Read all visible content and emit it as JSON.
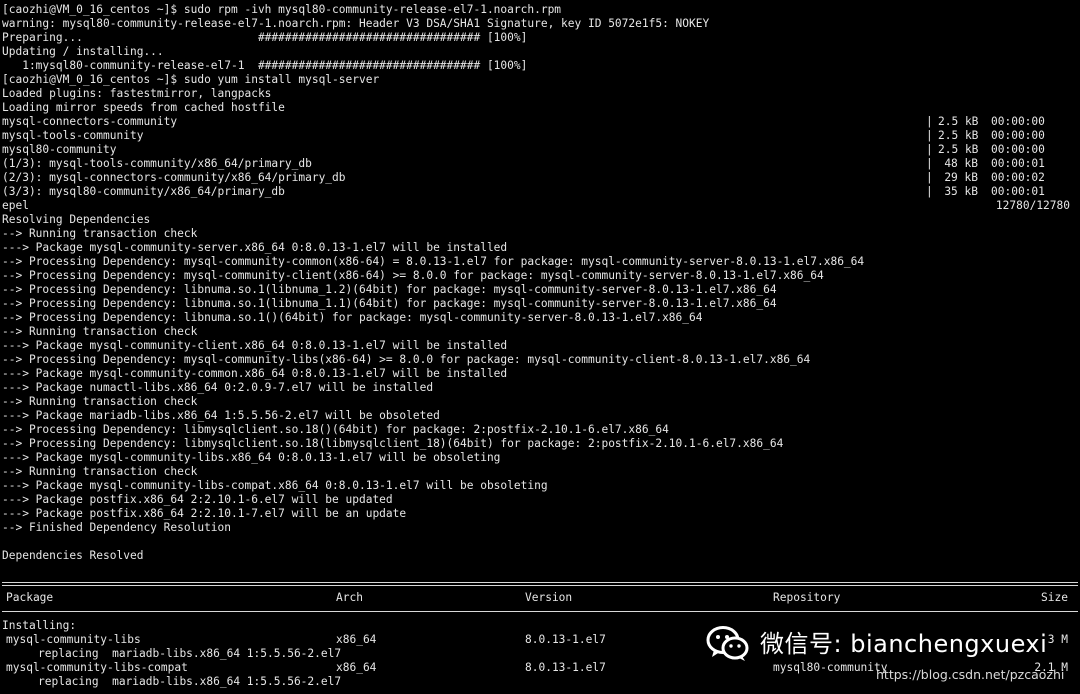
{
  "terminal": {
    "lines": [
      "[caozhi@VM_0_16_centos ~]$ sudo rpm -ivh mysql80-community-release-el7-1.noarch.rpm",
      "warning: mysql80-community-release-el7-1.noarch.rpm: Header V3 DSA/SHA1 Signature, key ID 5072e1f5: NOKEY",
      "Preparing...                          ################################# [100%]",
      "Updating / installing...",
      "   1:mysql80-community-release-el7-1  ################################# [100%]",
      "[caozhi@VM_0_16_centos ~]$ sudo yum install mysql-server",
      "Loaded plugins: fastestmirror, langpacks",
      "Loading mirror speeds from cached hostfile"
    ],
    "repo_lines": [
      {
        "name": "mysql-connectors-community",
        "bar": "|",
        "size": "2.5 kB",
        "time": "00:00:00"
      },
      {
        "name": "mysql-tools-community",
        "bar": "|",
        "size": "2.5 kB",
        "time": "00:00:00"
      },
      {
        "name": "mysql80-community",
        "bar": "|",
        "size": "2.5 kB",
        "time": "00:00:00"
      },
      {
        "name": "(1/3): mysql-tools-community/x86_64/primary_db",
        "bar": "|",
        "size": "48 kB",
        "time": "00:00:01"
      },
      {
        "name": "(2/3): mysql-connectors-community/x86_64/primary_db",
        "bar": "|",
        "size": "29 kB",
        "time": "00:00:02"
      },
      {
        "name": "(3/3): mysql80-community/x86_64/primary_db",
        "bar": "|",
        "size": "35 kB",
        "time": "00:00:01"
      }
    ],
    "epel": {
      "name": "epel",
      "count": "12780/12780"
    },
    "dep_lines": [
      "Resolving Dependencies",
      "--> Running transaction check",
      "---> Package mysql-community-server.x86_64 0:8.0.13-1.el7 will be installed",
      "--> Processing Dependency: mysql-community-common(x86-64) = 8.0.13-1.el7 for package: mysql-community-server-8.0.13-1.el7.x86_64",
      "--> Processing Dependency: mysql-community-client(x86-64) >= 8.0.0 for package: mysql-community-server-8.0.13-1.el7.x86_64",
      "--> Processing Dependency: libnuma.so.1(libnuma_1.2)(64bit) for package: mysql-community-server-8.0.13-1.el7.x86_64",
      "--> Processing Dependency: libnuma.so.1(libnuma_1.1)(64bit) for package: mysql-community-server-8.0.13-1.el7.x86_64",
      "--> Processing Dependency: libnuma.so.1()(64bit) for package: mysql-community-server-8.0.13-1.el7.x86_64",
      "--> Running transaction check",
      "---> Package mysql-community-client.x86_64 0:8.0.13-1.el7 will be installed",
      "--> Processing Dependency: mysql-community-libs(x86-64) >= 8.0.0 for package: mysql-community-client-8.0.13-1.el7.x86_64",
      "---> Package mysql-community-common.x86_64 0:8.0.13-1.el7 will be installed",
      "---> Package numactl-libs.x86_64 0:2.0.9-7.el7 will be installed",
      "--> Running transaction check",
      "---> Package mariadb-libs.x86_64 1:5.5.56-2.el7 will be obsoleted",
      "--> Processing Dependency: libmysqlclient.so.18()(64bit) for package: 2:postfix-2.10.1-6.el7.x86_64",
      "--> Processing Dependency: libmysqlclient.so.18(libmysqlclient_18)(64bit) for package: 2:postfix-2.10.1-6.el7.x86_64",
      "---> Package mysql-community-libs.x86_64 0:8.0.13-1.el7 will be obsoleting",
      "--> Running transaction check",
      "---> Package mysql-community-libs-compat.x86_64 0:8.0.13-1.el7 will be obsoleting",
      "---> Package postfix.x86_64 2:2.10.1-6.el7 will be updated",
      "---> Package postfix.x86_64 2:2.10.1-7.el7 will be an update",
      "--> Finished Dependency Resolution",
      "",
      "Dependencies Resolved"
    ],
    "table": {
      "headers": {
        "package": "Package",
        "arch": "Arch",
        "version": "Version",
        "repository": "Repository",
        "size": "Size"
      },
      "section": "Installing:",
      "rows": [
        {
          "package": "mysql-community-libs",
          "arch": "x86_64",
          "version": "8.0.13-1.el7",
          "repository": "",
          "size": "3 M"
        },
        {
          "package": "replacing  mariadb-libs.x86_64 1:5.5.56-2.el7",
          "arch": "",
          "version": "",
          "repository": "",
          "size": ""
        },
        {
          "package": "mysql-community-libs-compat",
          "arch": "x86_64",
          "version": "8.0.13-1.el7",
          "repository": "mysql80-community",
          "size": "2.1 M"
        },
        {
          "package": "replacing  mariadb-libs.x86_64 1:5.5.56-2.el7",
          "arch": "",
          "version": "",
          "repository": "",
          "size": ""
        }
      ]
    }
  },
  "watermark": {
    "text": "微信号: bianchengxuexi",
    "url": "https://blog.csdn.net/pzcaozhi"
  }
}
